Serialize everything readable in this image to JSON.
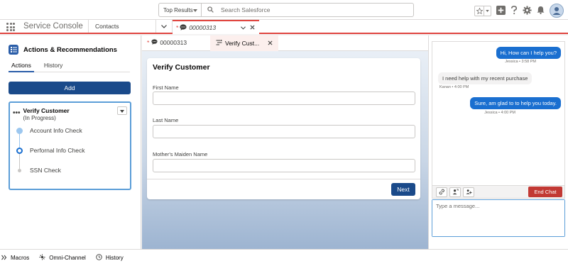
{
  "colors": {
    "brand": "#1a4a8a",
    "accent_red": "#e0453f",
    "chat_blue": "#1a6fd0",
    "end_chat": "#c23934"
  },
  "header": {
    "search_scope": "Top Results",
    "search_placeholder": "Search Salesforce",
    "icons": [
      "star-icon",
      "add-icon",
      "help-icon",
      "gear-icon",
      "bell-icon",
      "avatar"
    ]
  },
  "app_nav": {
    "app_name": "Service Console",
    "tab_contacts": "Contacts",
    "active_tab_star": "*",
    "active_tab_label": "00000313"
  },
  "left_panel": {
    "title": "Actions & Recommendations",
    "tabs": [
      {
        "label": "Actions"
      },
      {
        "label": "History"
      }
    ],
    "add_label": "Add",
    "flow": {
      "dots": "•••",
      "title": "Verify Customer",
      "status": "(In Progress)",
      "steps": [
        {
          "label": "Account Info Check",
          "state": "done"
        },
        {
          "label": "Perfornal Info Check",
          "state": "current"
        },
        {
          "label": "SSN Check",
          "state": "pending"
        }
      ]
    }
  },
  "workspace": {
    "subtab1_star": "*",
    "subtab1_label": "00000313",
    "subtab2_label": "Verify Cust...",
    "card_title": "Verify Customer",
    "fields": [
      {
        "label": "First Name",
        "value": ""
      },
      {
        "label": "Last Name",
        "value": ""
      },
      {
        "label": "Mother's Maiden Name",
        "value": ""
      }
    ],
    "next_label": "Next"
  },
  "chat": {
    "messages": [
      {
        "direction": "out",
        "text": "Hi, How can I help you?",
        "meta": "Jessica • 3:58 PM"
      },
      {
        "direction": "in",
        "text": "I need help with my recent purchase",
        "meta": "Kanan • 4:00 PM"
      },
      {
        "direction": "out",
        "text": "Sure, am glad to to help you today.",
        "meta": "Jessica • 4:00 PM"
      }
    ],
    "end_chat_label": "End Chat",
    "input_placeholder": "Type a message..."
  },
  "utility_bar": {
    "items": [
      {
        "label": "Macros"
      },
      {
        "label": "Omni-Channel"
      },
      {
        "label": "History"
      }
    ]
  }
}
